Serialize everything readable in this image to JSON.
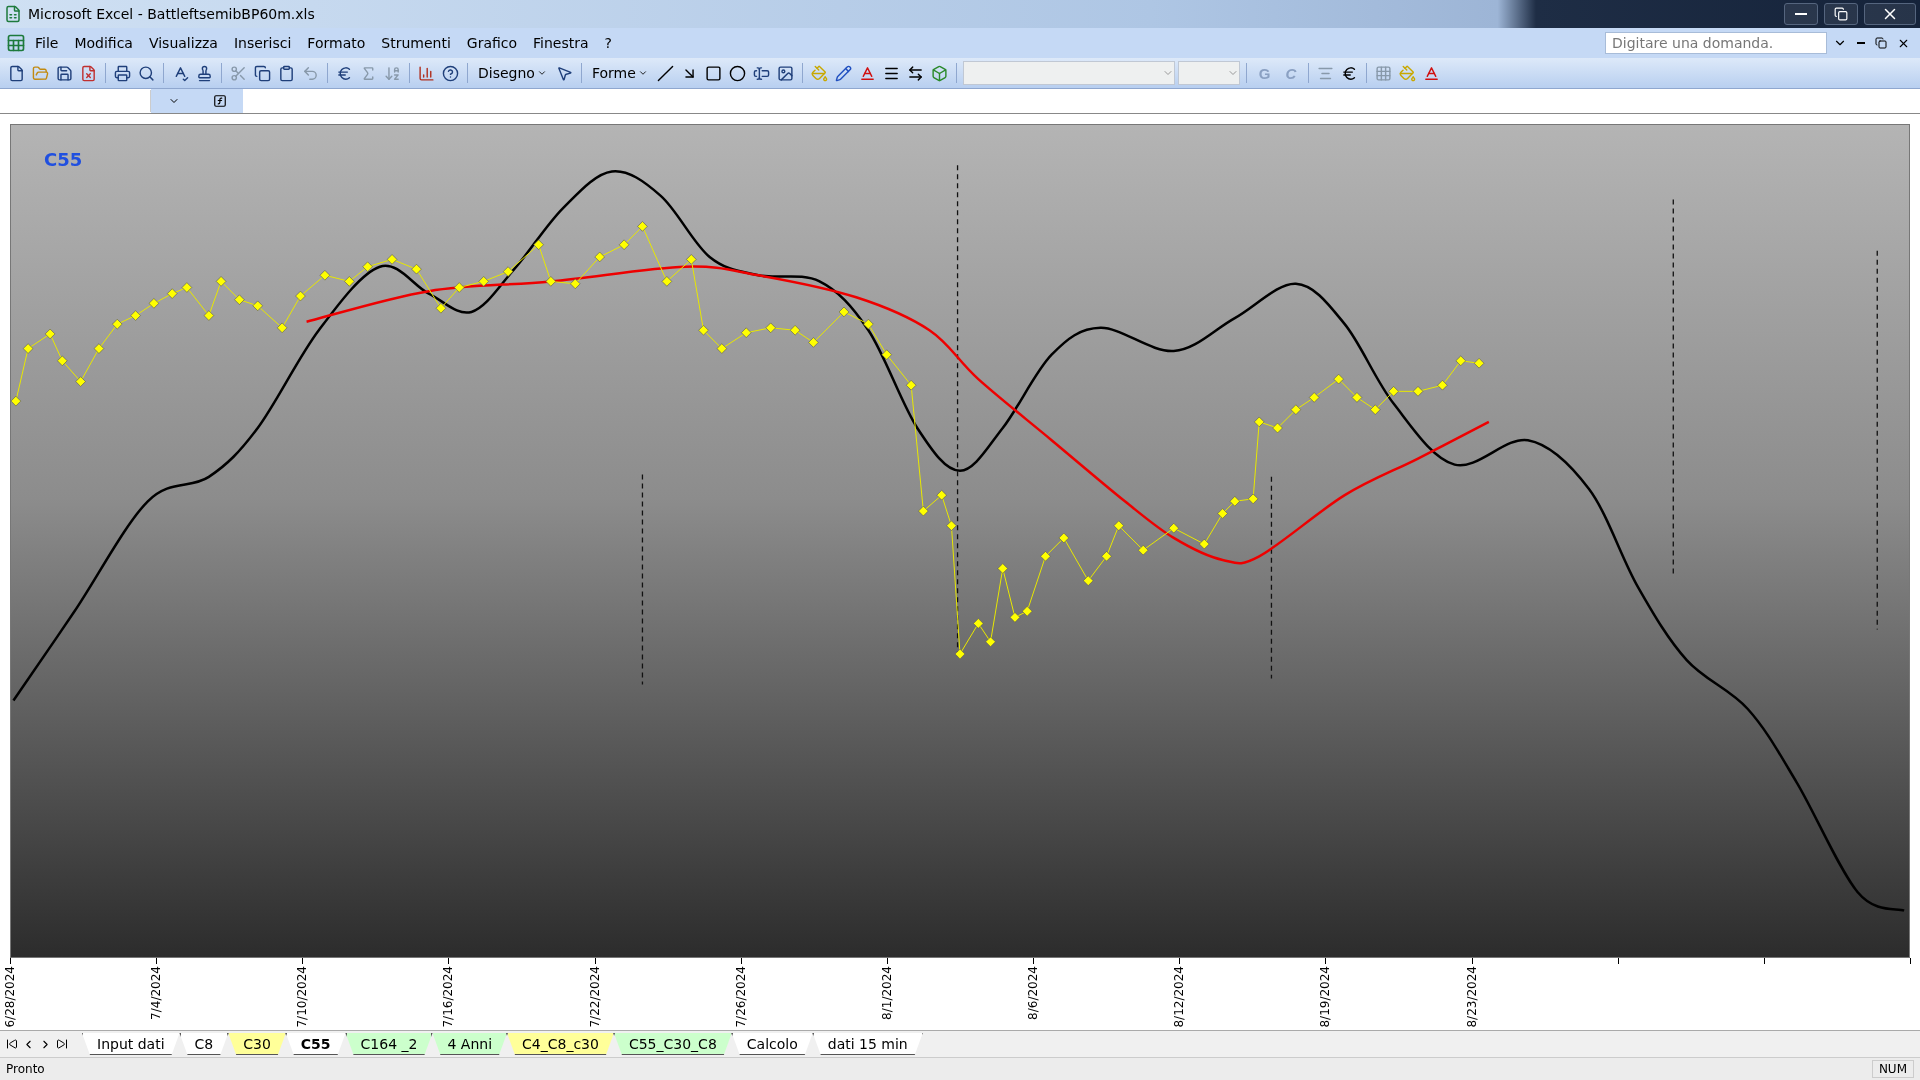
{
  "window": {
    "title": "Microsoft Excel - BattleftsemibBP60m.xls"
  },
  "menu": [
    {
      "label": "File"
    },
    {
      "label": "Modifica"
    },
    {
      "label": "Visualizza"
    },
    {
      "label": "Inserisci"
    },
    {
      "label": "Formato"
    },
    {
      "label": "Strumenti"
    },
    {
      "label": "Grafico"
    },
    {
      "label": "Finestra"
    },
    {
      "label": "?"
    }
  ],
  "help_box": {
    "placeholder": "Digitare una domanda."
  },
  "toolbar": {
    "drawing_menu": "Disegno",
    "shapes_menu": "Forme",
    "bold": "G",
    "italic": "C"
  },
  "chart": {
    "title": "C55",
    "x_labels": [
      "6/28/2024",
      "7/4/2024",
      "7/10/2024",
      "7/16/2024",
      "7/22/2024",
      "7/26/2024",
      "8/1/2024",
      "8/6/2024",
      "8/12/2024",
      "8/19/2024",
      "8/23/2024"
    ]
  },
  "sheet_tabs": [
    {
      "label": "Input dati",
      "selected": false,
      "color": "#ffffff"
    },
    {
      "label": "C8",
      "selected": false,
      "color": "#ffffff"
    },
    {
      "label": "C30",
      "selected": false,
      "color": "#ffff99"
    },
    {
      "label": "C55",
      "selected": true,
      "color": "#ffffff"
    },
    {
      "label": "C164 _2",
      "selected": false,
      "color": "#ccffcc"
    },
    {
      "label": "4 Anni",
      "selected": false,
      "color": "#ccffcc"
    },
    {
      "label": "C4_C8_c30",
      "selected": false,
      "color": "#ffff99"
    },
    {
      "label": "C55_C30_C8",
      "selected": false,
      "color": "#ccffcc"
    },
    {
      "label": "Calcolo",
      "selected": false,
      "color": "#ffffff"
    },
    {
      "label": "dati 15 min",
      "selected": false,
      "color": "#ffffff"
    }
  ],
  "status_bar": {
    "text": "Pronto",
    "num": "NUM"
  }
}
